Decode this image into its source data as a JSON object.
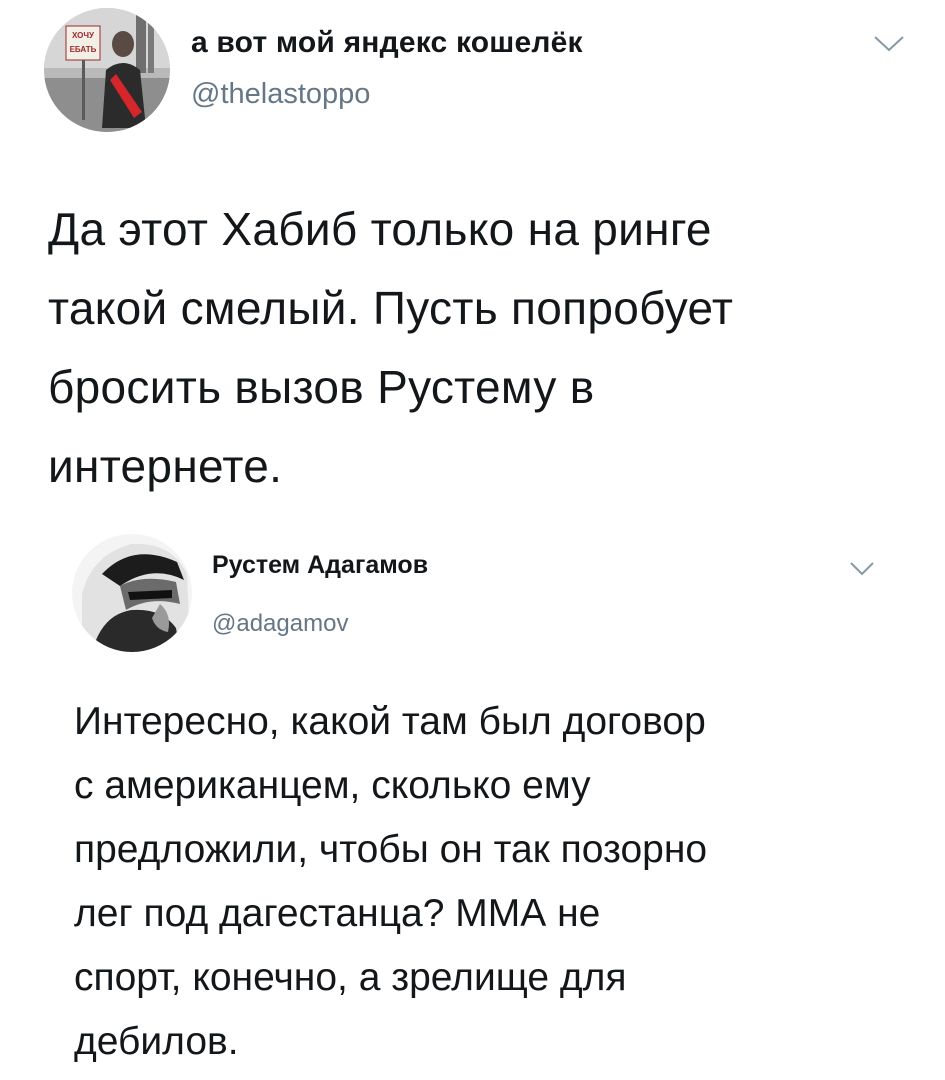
{
  "tweets": [
    {
      "author_name": "а вот мой яндекс кошелёк",
      "handle": "@thelastoppo",
      "avatar_sign_text": "ХОЧУ ЕБАТЬ",
      "menu_icon": "chevron-down-icon",
      "text": "Да этот Хабиб только на ринге\nтакой смелый. Пусть попробует\nбросить вызов Рустему в\nинтернете."
    },
    {
      "author_name": "Рустем Адагамов",
      "handle": "@adagamov",
      "menu_icon": "chevron-down-icon",
      "text": "Интересно, какой там был договор\nс американцем, сколько ему\nпредложили, чтобы он так позорно\nлег под дагестанца? ММА не\nспорт, конечно, а зрелище для\nдебилов."
    }
  ],
  "colors": {
    "name": "#14171a",
    "handle": "#657786",
    "chevron": "#8899a6"
  }
}
